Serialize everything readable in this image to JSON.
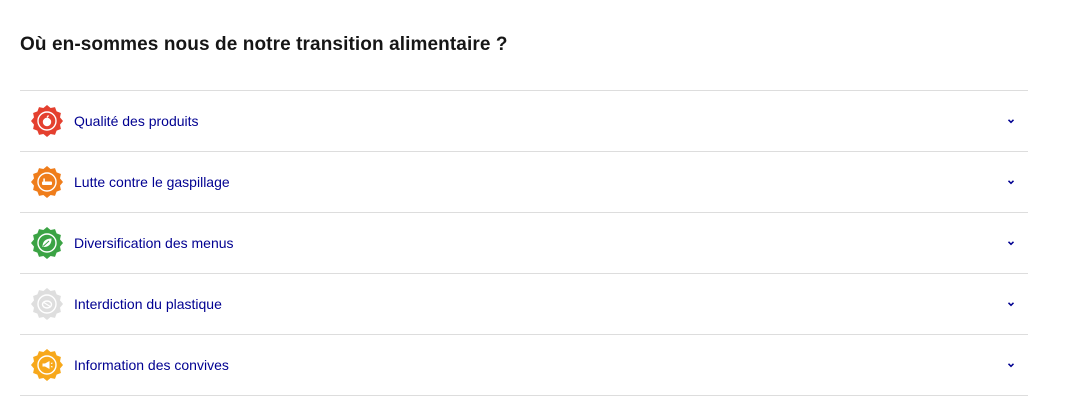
{
  "section": {
    "title": "Où en-sommes nous de notre transition alimentaire ?"
  },
  "accordion": {
    "items": [
      {
        "label": "Qualité des produits",
        "icon": "apple-icon",
        "color": "#e4402f"
      },
      {
        "label": "Lutte contre le gaspillage",
        "icon": "waste-icon",
        "color": "#ef7d1b"
      },
      {
        "label": "Diversification des menus",
        "icon": "leaf-icon",
        "color": "#3ba344"
      },
      {
        "label": "Interdiction du plastique",
        "icon": "plastic-icon",
        "color": "#dedede"
      },
      {
        "label": "Information des convives",
        "icon": "megaphone-icon",
        "color": "#f7a81b"
      }
    ]
  },
  "colors": {
    "label_text": "#000091",
    "title_text": "#161616",
    "divider": "#dddddd"
  }
}
